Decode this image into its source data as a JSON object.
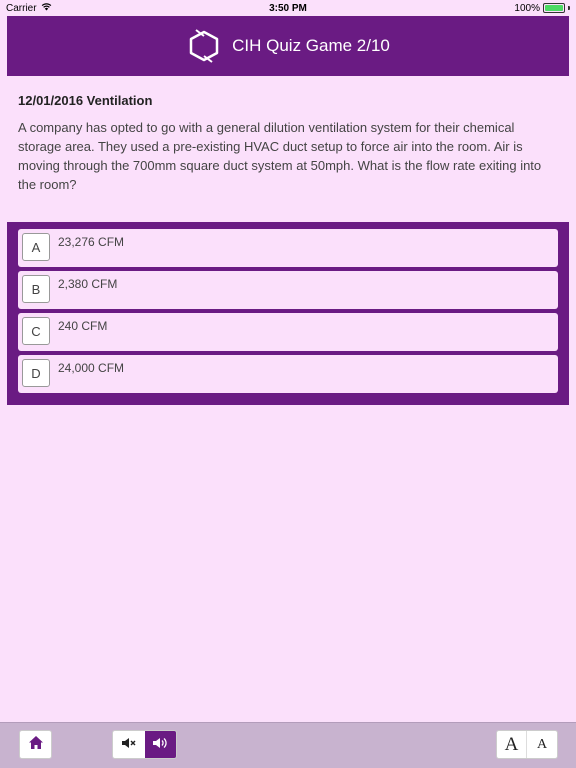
{
  "status_bar": {
    "carrier": "Carrier",
    "time": "3:50 PM",
    "battery": "100%"
  },
  "header": {
    "title": "CIH Quiz Game 2/10",
    "color": "#6a1b83"
  },
  "question": {
    "heading": "12/01/2016 Ventilation",
    "text": "A company has opted to go with a general dilution ventilation system for their chemical storage area. They used a pre-existing HVAC duct setup to force air into the room. Air is moving through the 700mm square duct system at 50mph. What is the flow rate exiting into the room?"
  },
  "answers": [
    {
      "letter": "A",
      "text": "23,276 CFM"
    },
    {
      "letter": "B",
      "text": "2,380 CFM"
    },
    {
      "letter": "C",
      "text": "240 CFM"
    },
    {
      "letter": "D",
      "text": "24,000 CFM"
    }
  ],
  "toolbar": {
    "home_icon": "home-icon",
    "mute_icon": "speaker-mute-icon",
    "sound_icon": "speaker-on-icon",
    "font_large_label": "A",
    "font_small_label": "A"
  },
  "colors": {
    "background": "#fbe0fb",
    "accent": "#6a1b83",
    "toolbar": "#c8b3cf"
  }
}
